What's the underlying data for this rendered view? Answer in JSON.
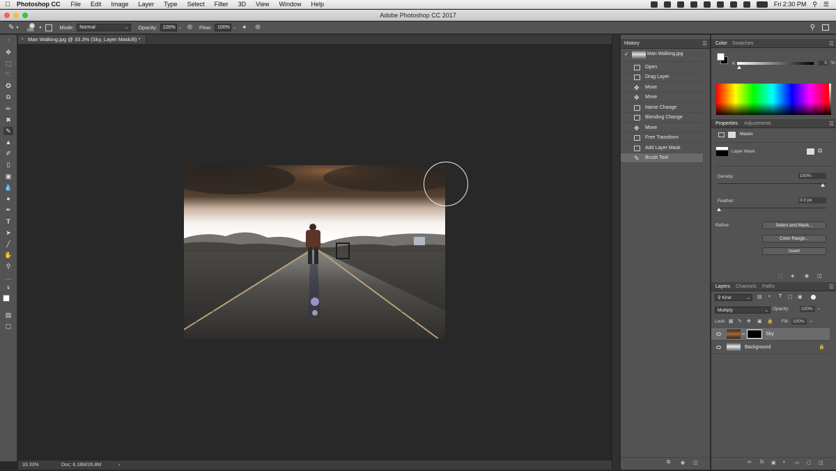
{
  "menubar": {
    "app_name": "Photoshop CC",
    "items": [
      "File",
      "Edit",
      "Image",
      "Layer",
      "Type",
      "Select",
      "Filter",
      "3D",
      "View",
      "Window",
      "Help"
    ],
    "clock": "Fri 2:30 PM"
  },
  "window": {
    "title": "Adobe Photoshop CC 2017"
  },
  "options": {
    "brush_size": "396",
    "mode_label": "Mode:",
    "mode_value": "Normal",
    "opacity_label": "Opacity:",
    "opacity_value": "100%",
    "flow_label": "Flow:",
    "flow_value": "100%"
  },
  "document": {
    "tab_title": "Man Walking.jpg @ 33.3% (Sky, Layer Mask/8) *",
    "zoom": "33.33%",
    "doc_size": "Doc: 6.18M/26.8M"
  },
  "history": {
    "title": "History",
    "snapshot": "Man Walking.jpg",
    "items": [
      "Open",
      "Drag Layer",
      "Move",
      "Move",
      "Name Change",
      "Blending Change",
      "Move",
      "Free Transform",
      "Add Layer Mask",
      "Brush Tool"
    ]
  },
  "color": {
    "tabs": [
      "Color",
      "Swatches"
    ],
    "channel": "K",
    "value": "0",
    "unit": "%"
  },
  "properties": {
    "tabs": [
      "Properties",
      "Adjustments"
    ],
    "section": "Masks",
    "mask_label": "Layer Mask",
    "density_label": "Density:",
    "density_value": "100%",
    "feather_label": "Feather:",
    "feather_value": "0.0 px",
    "refine_label": "Refine:",
    "btn_select_mask": "Select and Mask...",
    "btn_color_range": "Color Range...",
    "btn_invert": "Invert"
  },
  "layers": {
    "tabs": [
      "Layers",
      "Channels",
      "Paths"
    ],
    "filter": "Kind",
    "blend_mode": "Multiply",
    "opacity_label": "Opacity:",
    "opacity_value": "100%",
    "lock_label": "Lock:",
    "fill_label": "Fill:",
    "fill_value": "100%",
    "rows": [
      {
        "name": "Sky"
      },
      {
        "name": "Background"
      }
    ]
  }
}
